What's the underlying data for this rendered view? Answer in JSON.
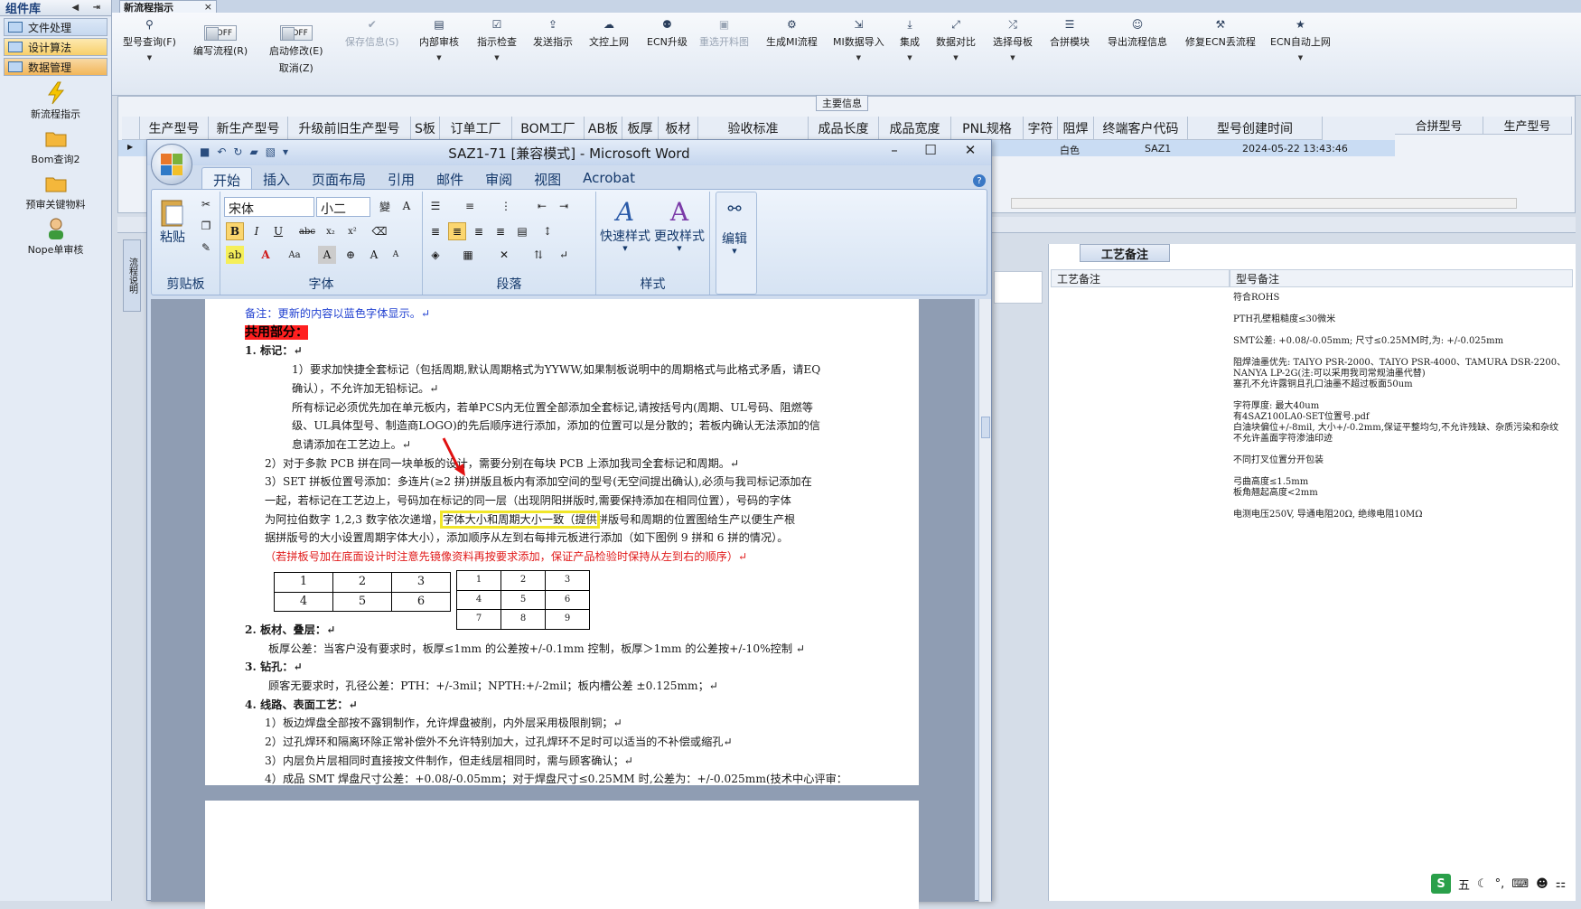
{
  "left_panel": {
    "title": "组件库",
    "categories": [
      "文件处理",
      "设计算法",
      "数据管理"
    ],
    "tools": [
      "新流程指示",
      "Bom查询2",
      "预审关键物料",
      "Nope单审核"
    ]
  },
  "tab": {
    "label": "新流程指示"
  },
  "toolbar": {
    "items": [
      "型号查询(F)",
      "编写流程(R)",
      "启动修改(E)",
      "保存信息(S)",
      "内部审核",
      "指示检查",
      "发送指示",
      "文控上网",
      "ECN升级",
      "重选开料图",
      "生成MI流程",
      "MI数据导入",
      "集成",
      "数据对比",
      "选择母板",
      "合拼模块",
      "导出流程信息",
      "修复ECN丢流程",
      "ECN自动上网"
    ],
    "cancel": "取消(Z)",
    "off": "OFF"
  },
  "main_info": {
    "label": "主要信息",
    "columns": [
      "生产型号",
      "新生产型号",
      "升级前旧生产型号",
      "S板",
      "订单工厂",
      "BOM工厂",
      "AB板",
      "板厚",
      "板材",
      "验收标准",
      "成品长度",
      "成品宽度",
      "PNL规格",
      "字符",
      "阻焊",
      "终端客户代码",
      "型号创建时间"
    ],
    "right_columns": [
      "合拼型号",
      "生产型号"
    ],
    "row": {
      "zuhan": "白色",
      "customer": "SAZ1",
      "created": "2024-05-22 13:43:46"
    }
  },
  "lower": {
    "vertical_tab": "流程说明",
    "tab": "工艺备注",
    "col1": "工艺备注",
    "col2": "型号备注",
    "notes": [
      "符合ROHS",
      "PTH孔壁粗糙度≤30微米",
      "SMT公差: +0.08/-0.05mm; 尺寸≤0.25MM时,为: +/-0.025mm",
      "阻焊油墨优先: TAIYO PSR-2000、TAIYO PSR-4000、TAMURA DSR-2200、 NANYA LP-2G(注:可以采用我司常规油墨代替)",
      "塞孔不允许露铜且孔口油墨不超过板面50um",
      "字符厚度: 最大40um",
      "有4SAZ100LA0-SET位置号.pdf",
      "白油块偏位+/-8mil, 大小+/-0.2mm,保证平整均匀,不允许残缺、杂质污染和杂纹",
      "不允许盖面字符渗油印迹",
      "不同打叉位置分开包装",
      "弓曲高度≤1.5mm",
      "板角翘起高度<2mm",
      "电测电压250V, 导通电阻20Ω, 绝缘电阻10MΩ"
    ]
  },
  "word": {
    "title": "SAZ1-71 [兼容模式] - Microsoft Word",
    "tabs": [
      "开始",
      "插入",
      "页面布局",
      "引用",
      "邮件",
      "审阅",
      "视图",
      "Acrobat"
    ],
    "font_name": "宋体",
    "font_size": "小二",
    "groups": {
      "clipboard": "剪贴板",
      "font": "字体",
      "paragraph": "段落",
      "styles": "样式"
    },
    "paste": "粘贴",
    "quick_styles": "快速样式",
    "change_styles": "更改样式",
    "edit": "编辑",
    "doc": {
      "note": "备注：更新的内容以蓝色字体显示。↵",
      "shared": "共用部分：",
      "h1": "1.  标记：↵",
      "p1a": "1）要求加快捷全套标记（包括周期,默认周期格式为YYWW,如果制板说明中的周期格式与此格式矛盾，请EQ",
      "p1b": "确认），不允许加无铅标记。↵",
      "p1c": "所有标记必须优先加在单元板内，若单PCS内无位置全部添加全套标记,请按括号内(周期、UL号码、阻燃等",
      "p1d": "级、UL具体型号、制造商LOGO)的先后顺序进行添加，添加的位置可以是分散的；若板内确认无法添加的信",
      "p1e": "息请添加在工艺边上。↵",
      "p2": "2）对于多款 PCB 拼在同一块单板的设计，需要分别在每块 PCB 上添加我司全套标记和周期。↵",
      "p3a": "3）SET 拼板位置号添加：多连片(≥2 拼)拼版且板内有添加空间的型号(无空间提出确认),必须与我司标记添加在",
      "p3b": "一起，若标记在工艺边上，号码加在标记的同一层（出现阴阳拼版时,需要保持添加在相同位置），号码的字体",
      "p3c1": "为阿拉伯数字 1,2,3 数字依次递增，",
      "p3c2": "字体大小和周期大小一致（提供",
      "p3c3": "拼版号和周期的位置图给生产以便生产根",
      "p3d": "据拼版号的大小设置周期字体大小），添加顺序从左到右每排元板进行添加（如下图例 9 拼和 6 拼的情况）。",
      "p3e": "（若拼板号加在底面设计时注意先镜像资料再按要求添加，保证产品检验时保持从左到右的顺序）↵",
      "t1": [
        [
          "1",
          "2",
          "3"
        ],
        [
          "4",
          "5",
          "6"
        ]
      ],
      "t2": [
        [
          "1",
          "2",
          "3"
        ],
        [
          "4",
          "5",
          "6"
        ],
        [
          "7",
          "8",
          "9"
        ]
      ],
      "h2": "2.  板材、叠层：↵",
      "p4": "板厚公差：当客户没有要求时，板厚≤1mm 的公差按+/-0.1mm 控制，板厚＞1mm 的公差按+/-10%控制      ↵",
      "h3": "3.  钻孔：↵",
      "p5": "顾客无要求时，孔径公差：PTH：+/-3mil；NPTH:+/-2mil；板内槽公差 ±0.125mm；↵",
      "h4": "4.  线路、表面工艺：↵",
      "p6": "1）板边焊盘全部按不露铜制作，允许焊盘被削，内外层采用极限削铜；↵",
      "p7": "2）过孔焊环和隔离环除正常补偿外不允许特别加大，过孔焊环不足时可以适当的不补偿或缩孔↵",
      "p8": "3）内层负片层相同时直接按文件制作，但走线层相同时，需与顾客确认；↵",
      "p9": "4）成品 SMT 焊盘尺寸公差：+0.08/-0.05mm；对于焊盘尺寸≤0.25MM 时,公差为：+/-0.025mm(技术中心评审："
    }
  },
  "tray": {
    "ime": "五"
  }
}
